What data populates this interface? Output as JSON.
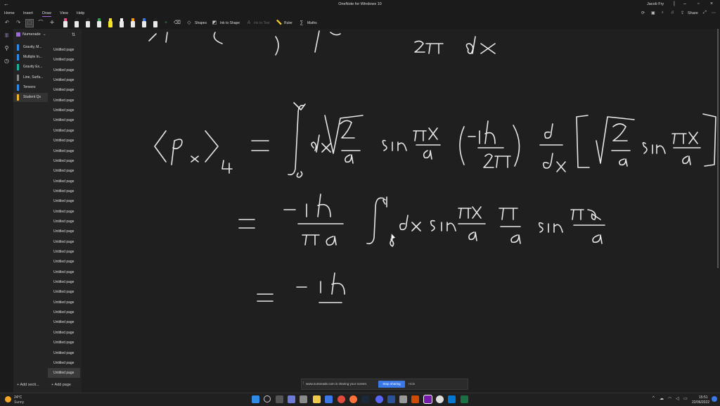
{
  "window": {
    "title": "OneNote for Windows 10",
    "user": "Jacob Fry"
  },
  "menu": [
    "Home",
    "Insert",
    "Draw",
    "View",
    "Help"
  ],
  "menu_active": "Draw",
  "share_label": "Share",
  "ribbon": {
    "shapes_label": "Shapes",
    "ink_to_shape_label": "Ink to Shape",
    "ink_to_text_label": "Ink to Text",
    "ruler_label": "Ruler",
    "maths_label": "Maths"
  },
  "notebook": {
    "name": "Numerade"
  },
  "sections": [
    {
      "label": "Gravity, M...",
      "color": "#2f8ce6"
    },
    {
      "label": "Multiple In...",
      "color": "#2f8ce6"
    },
    {
      "label": "Gravity Ex...",
      "color": "#19b39b"
    },
    {
      "label": "Line, Surfa...",
      "color": "#888888"
    },
    {
      "label": "Tensors",
      "color": "#2f8ce6"
    },
    {
      "label": "Student Qs",
      "color": "#f0b429"
    }
  ],
  "selected_section": "Student Qs",
  "page_label": "Untitled page",
  "pages_count": 33,
  "add_section_label": "Add secti...",
  "add_page_label": "Add page",
  "share_notice": {
    "message": "www.numerade.com is sharing your screen.",
    "stop_label": "Stop sharing",
    "hide_label": "Hide"
  },
  "taskbar": {
    "temperature": "24°C",
    "weather": "Sunny",
    "time": "15:51",
    "date": "22/06/2022"
  },
  "colors": {
    "accent": "#9b6ad6",
    "stop_button": "#3b78e7"
  },
  "pen_colors": [
    "#e84f8a",
    "#222222",
    "#2b2b2b",
    "#2aa14f",
    "#f5e32a",
    "#ffffff",
    "#ffa200",
    "#3b78e7",
    "#222222"
  ]
}
